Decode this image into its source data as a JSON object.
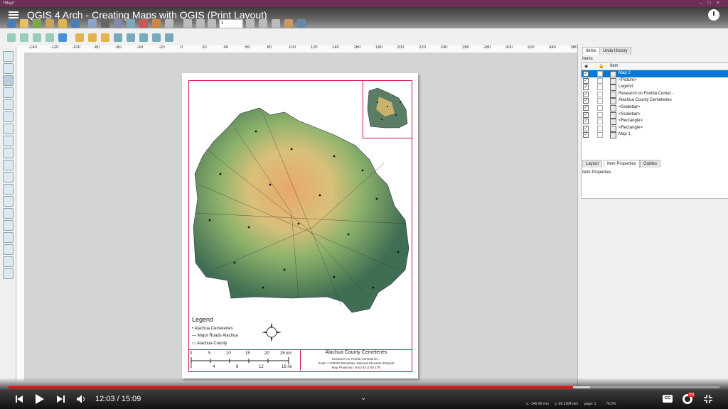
{
  "window": {
    "title": "*Map*"
  },
  "video": {
    "title": "QGIS 4 Arch - Creating Maps with QGIS (Print Layout)",
    "time": "12:03 / 15:09",
    "progress": 0.794,
    "buffered": 0.818
  },
  "ruler_top_labels": [
    "-140",
    "-120",
    "-100",
    "-80",
    "-60",
    "-40",
    "-20",
    "0",
    "20",
    "40",
    "60",
    "80",
    "100",
    "120",
    "140",
    "160",
    "180",
    "200",
    "220",
    "240",
    "260",
    "280",
    "300",
    "320",
    "340",
    "360"
  ],
  "map": {
    "legend_title": "Legend",
    "legend_items": [
      "Alachua Cemeteries",
      "Major Roads Alachua",
      "Alachua County"
    ],
    "scale_km": [
      "0",
      "5",
      "10",
      "15",
      "20",
      "25 km"
    ],
    "scale_mi": [
      "0",
      "4",
      "8",
      "12",
      "16 mi"
    ],
    "info_title": "Alachua County Cemeteries",
    "info_lines": [
      "Research on Florida Cemeteries...",
      "Scale 1:100000   BaseMap: National Elevation Dataset",
      "Map Projection: NAD 83 UTM 17N"
    ]
  },
  "panel": {
    "tabs_top": [
      "Items",
      "Undo History"
    ],
    "items_label": "Items",
    "col_item": "Item",
    "items": [
      {
        "label": "Map 2",
        "selected": true
      },
      {
        "label": "<Picture>",
        "selected": false
      },
      {
        "label": "Legend",
        "selected": false
      },
      {
        "label": "Research on Florida Cemet...",
        "selected": false
      },
      {
        "label": "Alachua County Cemeteries",
        "selected": false
      },
      {
        "label": "<Scalebar>",
        "selected": false
      },
      {
        "label": "<Scalebar>",
        "selected": false
      },
      {
        "label": "<Rectangle>",
        "selected": false
      },
      {
        "label": "<Rectangle>",
        "selected": false
      },
      {
        "label": "Map 1",
        "selected": false
      }
    ],
    "tabs_bottom": [
      "Layout",
      "Item Properties",
      "Guides"
    ],
    "props_title": "Item Properties"
  },
  "status": {
    "x": "x: -146.49 mm",
    "y": "y: 86.3284 mm",
    "page": "page: 1",
    "zoom": "76.2%"
  },
  "toolbar": {
    "page_value": "1"
  },
  "colors": {
    "accent": "#f00",
    "frame": "#c14",
    "selection": "#0078d7"
  }
}
